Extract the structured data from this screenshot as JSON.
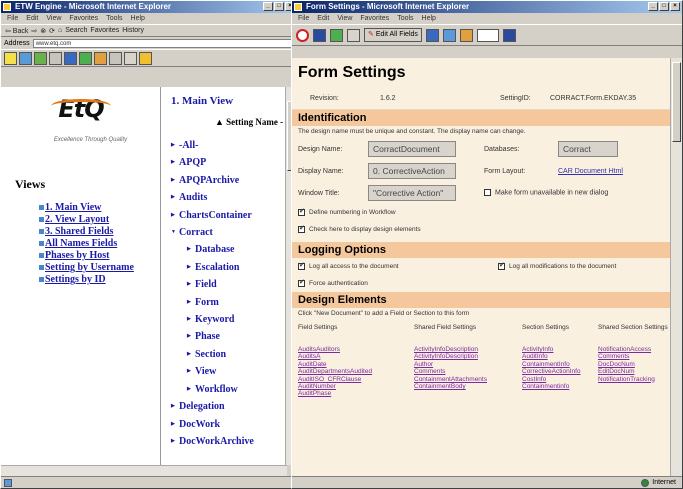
{
  "left_window": {
    "title": "ETW Engine - Microsoft Internet Explorer",
    "menu": [
      "File",
      "Edit",
      "View",
      "Favorites",
      "Tools",
      "Help"
    ],
    "toolbar": {
      "back": "⇦ Back",
      "search": "Search",
      "favorites": "Favorites",
      "history": "History"
    },
    "address": {
      "label": "Address",
      "value": "www.etq.com"
    },
    "logo": {
      "text": "EtQ",
      "tagline": "Excellence Through Quality"
    },
    "views_heading": "Views",
    "views": [
      "1. Main View",
      "2. View Layout",
      "3. Shared Fields",
      "All Names Fields",
      "Phases by Host",
      "Setting by Username",
      "Settings by ID"
    ],
    "main_view_heading": "1. Main View",
    "sort_label": "Setting Name -",
    "items": [
      {
        "label": "-All-",
        "level": 0,
        "open": false
      },
      {
        "label": "APQP",
        "level": 0,
        "open": false
      },
      {
        "label": "APQPArchive",
        "level": 0,
        "open": false
      },
      {
        "label": "Audits",
        "level": 0,
        "open": false
      },
      {
        "label": "ChartsContainer",
        "level": 0,
        "open": false
      },
      {
        "label": "Corract",
        "level": 0,
        "open": true
      },
      {
        "label": "Database",
        "level": 1,
        "open": false
      },
      {
        "label": "Escalation",
        "level": 1,
        "open": false
      },
      {
        "label": "Field",
        "level": 1,
        "open": false
      },
      {
        "label": "Form",
        "level": 1,
        "open": false
      },
      {
        "label": "Keyword",
        "level": 1,
        "open": false
      },
      {
        "label": "Phase",
        "level": 1,
        "open": false
      },
      {
        "label": "Section",
        "level": 1,
        "open": false
      },
      {
        "label": "View",
        "level": 1,
        "open": false
      },
      {
        "label": "Workflow",
        "level": 1,
        "open": false
      },
      {
        "label": "Delegation",
        "level": 0,
        "open": false
      },
      {
        "label": "DocWork",
        "level": 0,
        "open": false
      },
      {
        "label": "DocWorkArchive",
        "level": 0,
        "open": false
      }
    ]
  },
  "right_window": {
    "title": "Form Settings - Microsoft Internet Explorer",
    "menu": [
      "File",
      "Edit",
      "View",
      "Favorites",
      "Tools",
      "Help"
    ],
    "edit_all_fields": "Edit All Fields",
    "form_title": "Form Settings",
    "revision_label": "Revision:",
    "revision_value": "1.6.2",
    "setting_id_label": "SettingID:",
    "setting_id_value": "CORRACT.Form.EKDAY.35",
    "identification": {
      "heading": "Identification",
      "note": "The design name must be unique and constant. The display name can change.",
      "design_name_label": "Design Name:",
      "design_name_value": "CorractDocument",
      "databases_label": "Databases:",
      "databases_value": "Corract",
      "display_name_label": "Display Name:",
      "display_name_value": "0. CorrectiveAction",
      "form_layout_label": "Form Layout:",
      "form_layout_value": "CAR Document Html",
      "window_title_label": "Window Title:",
      "window_title_value": "\"Corrective Action\"",
      "unavailable_label": "Make form unavailable in new dialog",
      "define_numbering": "Define numbering in Workflow",
      "check_display": "Check here to display design elements"
    },
    "logging": {
      "heading": "Logging Options",
      "log_access": "Log all access to the document",
      "log_modifications": "Log all modifications to the document",
      "force_auth": "Force authentication"
    },
    "design_elements": {
      "heading": "Design Elements",
      "note": "Click \"New Document\" to add a Field or Section to this form",
      "columns": [
        "Field Settings",
        "Shared Field Settings",
        "Section Settings",
        "Shared Section Settings"
      ],
      "col1": [
        "AuditsAuditors",
        "AuditsA",
        "AuditDate",
        "AuditDepartmentsAudited",
        "AuditISO_CFRClause",
        "AuditNumber",
        "AuditPhase"
      ],
      "col2": [
        "ActivityInfoDescription",
        "ActivityInfoDescription",
        "Author",
        "Comments",
        "ContainmentAttachments",
        "ContainmentBody"
      ],
      "col3": [
        "ActivityInfo",
        "AuditInfo",
        "ContainmentInfo",
        "CorrectiveActionInfo",
        "CostInfo",
        "Containmentinfo"
      ],
      "col4": [
        "NotificationAccess",
        "Comments",
        "DocDocNum",
        "EditDocNum",
        "NotificationTracking"
      ]
    },
    "status": "Internet"
  }
}
